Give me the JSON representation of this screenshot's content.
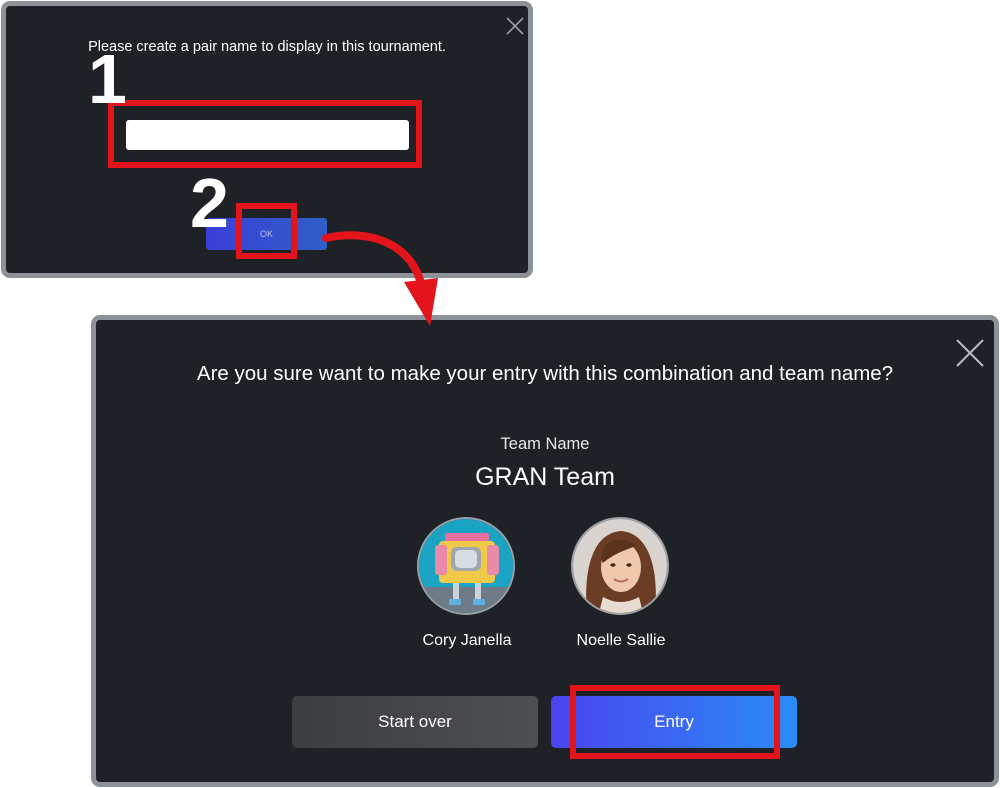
{
  "dialog1": {
    "prompt": "Please create a pair name to display in this tournament.",
    "input_value": "",
    "ok_label": "OK"
  },
  "dialog2": {
    "prompt": "Are you sure want to make your entry with this combination and team name?",
    "team_label": "Team Name",
    "team_name": "GRAN Team",
    "members": [
      {
        "name": "Cory Janella",
        "avatar": "retro-tv-robot-avatar"
      },
      {
        "name": "Noelle Sallie",
        "avatar": "woman-portrait-avatar"
      }
    ],
    "start_over_label": "Start over",
    "entry_label": "Entry"
  },
  "annotations": {
    "step1": "1",
    "step2": "2",
    "highlight_color": "#e3141c"
  },
  "colors": {
    "dialog_bg": "#1e2125",
    "dialog_border": "#8d9299",
    "entry_gradient_start": "#4a44f0",
    "entry_gradient_end": "#2a8cf5"
  },
  "icons": [
    "close-icon",
    "curved-arrow-icon"
  ]
}
